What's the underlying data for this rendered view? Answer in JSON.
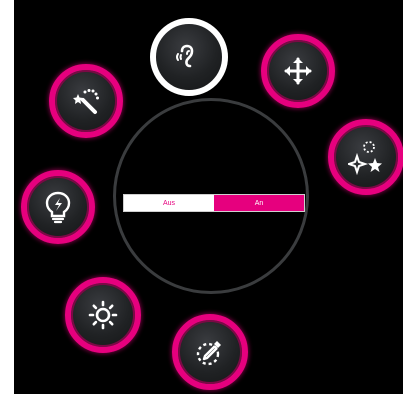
{
  "colors": {
    "accent": "#e6007e",
    "background": "#000000",
    "ring": "#3a3c3e",
    "selected_border": "#ffffff"
  },
  "toggle": {
    "off_label": "Aus",
    "on_label": "An",
    "selected": "An"
  },
  "buttons": [
    {
      "id": "hearing",
      "icon": "hearing-icon",
      "selected": true
    },
    {
      "id": "move",
      "icon": "move-arrows-icon",
      "selected": false
    },
    {
      "id": "magic-wand",
      "icon": "magic-wand-icon",
      "selected": false
    },
    {
      "id": "sparkle",
      "icon": "sparkle-stars-icon",
      "selected": false
    },
    {
      "id": "lightbulb",
      "icon": "lightbulb-icon",
      "selected": false
    },
    {
      "id": "brightness",
      "icon": "sun-icon",
      "selected": false
    },
    {
      "id": "color-picker",
      "icon": "eyedropper-icon",
      "selected": false
    }
  ]
}
